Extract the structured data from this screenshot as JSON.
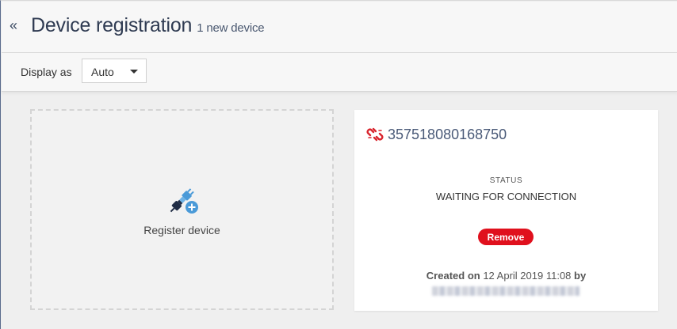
{
  "header": {
    "collapse_label": "«",
    "title": "Device registration",
    "subtitle": "1 new device"
  },
  "toolbar": {
    "display_label": "Display as",
    "display_value": "Auto"
  },
  "register_card": {
    "label": "Register device",
    "icon": "plug-add-icon"
  },
  "device_card": {
    "device_id": "357518080168750",
    "icon": "unlink-icon",
    "status_label": "STATUS",
    "status_value": "WAITING FOR CONNECTION",
    "remove_label": "Remove",
    "created_prefix": "Created on",
    "created_date": "12 April 2019 11:08",
    "created_by_label": "by"
  },
  "colors": {
    "accent_red": "#e0101d",
    "title_text": "#2f3b52",
    "icon_blue": "#4a9ad8"
  }
}
